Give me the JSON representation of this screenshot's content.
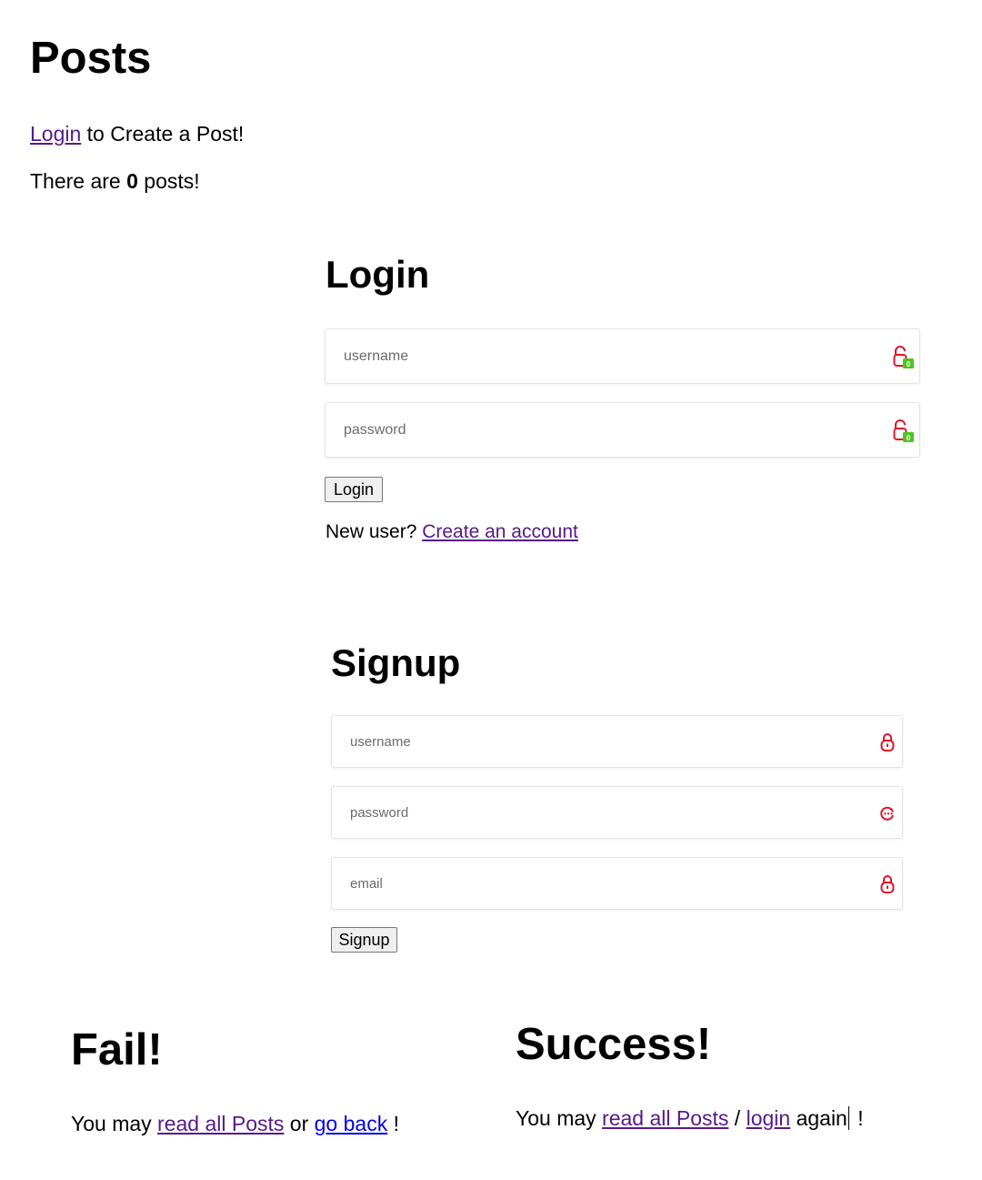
{
  "posts": {
    "title": "Posts",
    "login_link": "Login",
    "login_suffix": " to Create a Post!",
    "count_prefix": "There are ",
    "count": "0",
    "count_suffix": " posts!"
  },
  "login": {
    "title": "Login",
    "username_placeholder": "username",
    "password_placeholder": "password",
    "button_label": "Login",
    "new_user_text": "New user? ",
    "create_account_link": "Create an account"
  },
  "signup": {
    "title": "Signup",
    "username_placeholder": "username",
    "password_placeholder": "password",
    "email_placeholder": "email",
    "button_label": "Signup"
  },
  "fail": {
    "title": "Fail!",
    "prefix": "You may ",
    "read_all_link": "read all Posts",
    "middle": " or ",
    "go_back_link": "go back",
    "suffix": " !"
  },
  "success": {
    "title": "Success!",
    "prefix": "You may ",
    "read_all_link": "read all Posts",
    "separator": " / ",
    "login_link": "login",
    "again": " again",
    "suffix": " !"
  },
  "colors": {
    "visited_link": "#551a8b",
    "unvisited_link": "#0000ee",
    "password_manager_red": "#e0142b",
    "password_manager_green": "#4fc423"
  },
  "icons": {
    "password_manager": "password-manager-icon",
    "lock": "lock-icon",
    "dots": "generate-password-icon"
  }
}
